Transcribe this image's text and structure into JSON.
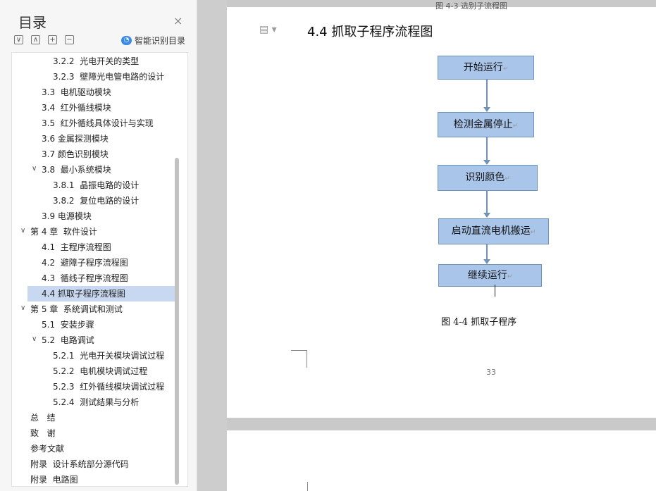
{
  "pane": {
    "title": "目录",
    "close_icon": "×",
    "tools": [
      "∨",
      "∧",
      "+",
      "−"
    ],
    "smart_icon": "ai-cloud-icon",
    "smart_label": "智能识别目录"
  },
  "toc": [
    {
      "num": "3.2.2",
      "text": "光电开关的类型"
    },
    {
      "num": "3.2.3",
      "text": "壁障光电管电路的设计"
    },
    {
      "num": "3.3",
      "text": "电机驱动模块"
    },
    {
      "num": "3.4",
      "text": "红外循线模块"
    },
    {
      "num": "3.5",
      "text": "红外循线具体设计与实现"
    },
    {
      "num": "3.6",
      "text": "金属探测模块"
    },
    {
      "num": "3.7",
      "text": "颜色识别模块"
    },
    {
      "num": "3.8",
      "text": "最小系统模块"
    },
    {
      "num": "3.8.1",
      "text": "晶振电路的设计"
    },
    {
      "num": "3.8.2",
      "text": "复位电路的设计"
    },
    {
      "num": "3.9",
      "text": "电源模块"
    },
    {
      "num": "第 4 章",
      "text": "软件设计"
    },
    {
      "num": "4.1",
      "text": "主程序流程图"
    },
    {
      "num": "4.2",
      "text": "避障子程序流程图"
    },
    {
      "num": "4.3",
      "text": "循线子程序流程图"
    },
    {
      "num": "4.4",
      "text": "抓取子程序流程图"
    },
    {
      "num": "第 5 章",
      "text": "系统调试和测试"
    },
    {
      "num": "5.1",
      "text": "安装步骤"
    },
    {
      "num": "5.2",
      "text": "电路调试"
    },
    {
      "num": "5.2.1",
      "text": "光电开关模块调试过程"
    },
    {
      "num": "5.2.2",
      "text": "电机模块调试过程"
    },
    {
      "num": "5.2.3",
      "text": "红外循线模块调试过程"
    },
    {
      "num": "5.2.4",
      "text": "测试结果与分析"
    },
    {
      "num": "总",
      "text": "结"
    },
    {
      "num": "致",
      "text": "谢"
    },
    {
      "num": "参考文献",
      "text": ""
    },
    {
      "num": "附录",
      "text": "设计系统部分源代码"
    },
    {
      "num": "附录",
      "text": "电路图"
    }
  ],
  "document": {
    "top_cutoff_text": "图 4-3 选别子流程图",
    "heading": "4.4 抓取子程序流程图",
    "flow": [
      "开始运行",
      "检测金属停止",
      "识别颜色",
      "启动直流电机搬运",
      "继续运行"
    ],
    "paragraph_mark": "↵",
    "caption": "图 4-4  抓取子程序",
    "page_number": "33"
  },
  "colors": {
    "selected_row": "#c8d8f0",
    "box_fill": "#a9c5ea",
    "box_border": "#6f92b9"
  }
}
